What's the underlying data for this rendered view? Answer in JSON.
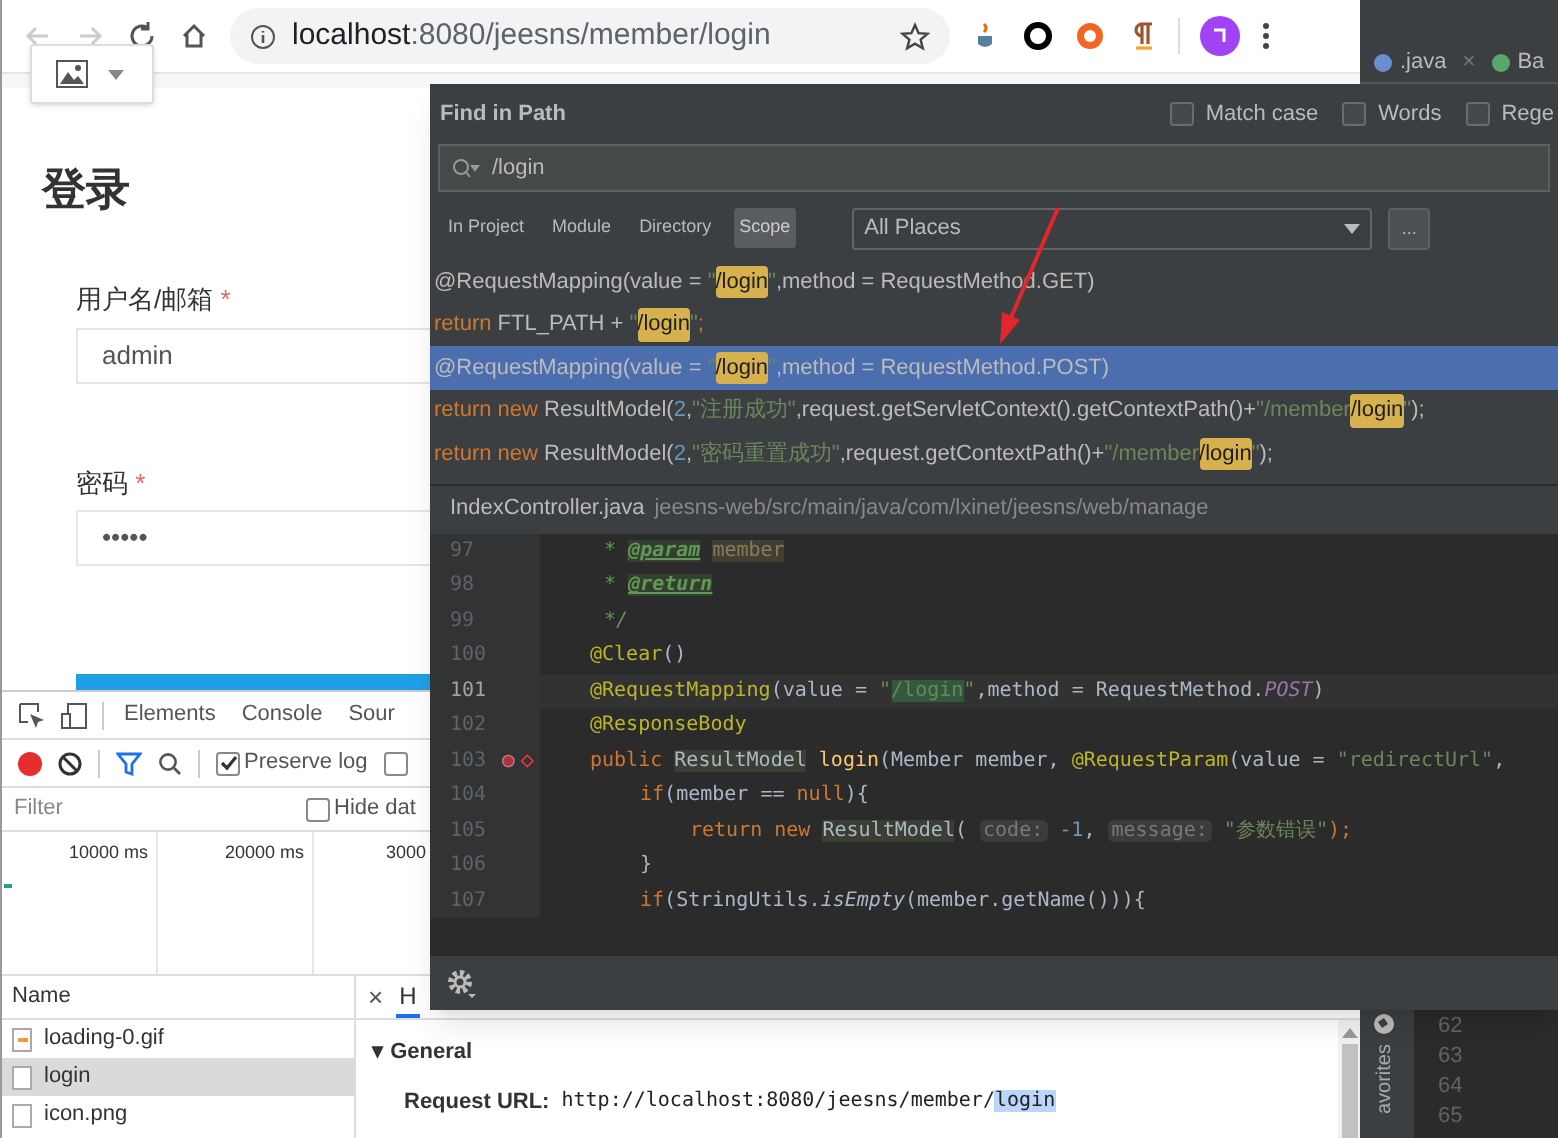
{
  "browser": {
    "address": {
      "host": "localhost",
      "rest": ":8080/jeesns/member/login"
    },
    "page": {
      "title": "登录",
      "fields": [
        {
          "label": "用户名/邮箱",
          "required_mark": "*",
          "value": "admin"
        },
        {
          "label": "密码",
          "required_mark": "*",
          "value": "•••••"
        }
      ]
    },
    "devtools": {
      "tabs": [
        {
          "label": "Elements",
          "selected": false
        },
        {
          "label": "Console",
          "selected": false
        },
        {
          "label": "Sour",
          "selected": false
        }
      ],
      "preserve_log": {
        "label": "Preserve log",
        "checked": true
      },
      "checkbox_2": {
        "checked": false
      },
      "filter": {
        "placeholder": "Filter"
      },
      "hide_data": {
        "label": "Hide dat",
        "checked": false
      },
      "timeline_ticks": [
        "10000 ms",
        "20000 ms",
        "3000"
      ],
      "name_header": "Name",
      "requests": [
        {
          "name": "loading-0.gif",
          "kind": "gif",
          "selected": false
        },
        {
          "name": "login",
          "kind": "doc",
          "selected": true
        },
        {
          "name": "icon.png",
          "kind": "doc",
          "selected": false
        }
      ],
      "close": "×",
      "detail_tab": "H",
      "section_toggle": "▾",
      "section": "General",
      "request_url": {
        "label": "Request URL:",
        "value": "http://localhost:8080/jeesns/member/",
        "match": "login"
      }
    }
  },
  "ide": {
    "tabs": [
      {
        "label": ".java",
        "close": "×"
      },
      {
        "label": "Ba"
      }
    ],
    "side_label": "avorites",
    "line_numbers": [
      "62",
      "63",
      "64",
      "65"
    ]
  },
  "find": {
    "title": "Find in Path",
    "options": [
      {
        "label": "Match case",
        "checked": false
      },
      {
        "label": "Words",
        "checked": false
      },
      {
        "label": "Rege",
        "checked": false
      }
    ],
    "query": "/login",
    "scopes": [
      {
        "label": "In Project",
        "selected": false
      },
      {
        "label": "Module",
        "selected": false
      },
      {
        "label": "Directory",
        "selected": false
      },
      {
        "label": "Scope",
        "selected": true
      }
    ],
    "scope_value": "All Places",
    "more": "...",
    "results": [
      {
        "selected": false,
        "segments": [
          {
            "t": "@RequestMapping(value = ",
            "kind": "plain"
          },
          {
            "t": "\"",
            "kind": "string"
          },
          {
            "t": "/login",
            "kind": "match"
          },
          {
            "t": "\"",
            "kind": "string"
          },
          {
            "t": ",method = RequestMethod.GET)",
            "kind": "plain"
          }
        ]
      },
      {
        "selected": false,
        "segments": [
          {
            "t": "return",
            "kind": "keyword"
          },
          {
            "t": " FTL_PATH + ",
            "kind": "plain"
          },
          {
            "t": "\"",
            "kind": "string"
          },
          {
            "t": "/login",
            "kind": "match"
          },
          {
            "t": "\"",
            "kind": "string"
          },
          {
            "t": ";",
            "kind": "keyword"
          }
        ]
      },
      {
        "selected": true,
        "segments": [
          {
            "t": "@RequestMapping(value = ",
            "kind": "plain"
          },
          {
            "t": "\"",
            "kind": "string"
          },
          {
            "t": "/login",
            "kind": "match"
          },
          {
            "t": "\"",
            "kind": "string"
          },
          {
            "t": ",method = RequestMethod.POST)",
            "kind": "plain"
          }
        ]
      },
      {
        "selected": false,
        "segments": [
          {
            "t": "return new",
            "kind": "keyword"
          },
          {
            "t": " ResultModel(",
            "kind": "plain"
          },
          {
            "t": "2",
            "kind": "number"
          },
          {
            "t": ",",
            "kind": "plain"
          },
          {
            "t": "\"注册成功\"",
            "kind": "string"
          },
          {
            "t": ",request.getServletContext().getContextPath()+",
            "kind": "plain"
          },
          {
            "t": "\"/member",
            "kind": "string"
          },
          {
            "t": "/login",
            "kind": "match"
          },
          {
            "t": "\"",
            "kind": "string"
          },
          {
            "t": ");",
            "kind": "plain"
          }
        ]
      },
      {
        "selected": false,
        "segments": [
          {
            "t": "return new",
            "kind": "keyword"
          },
          {
            "t": " ResultModel(",
            "kind": "plain"
          },
          {
            "t": "2",
            "kind": "number"
          },
          {
            "t": ",",
            "kind": "plain"
          },
          {
            "t": "\"密码重置成功\"",
            "kind": "string"
          },
          {
            "t": ",request.getContextPath()+",
            "kind": "plain"
          },
          {
            "t": "\"/member",
            "kind": "string"
          },
          {
            "t": "/login",
            "kind": "match"
          },
          {
            "t": "\"",
            "kind": "string"
          },
          {
            "t": ");",
            "kind": "plain"
          }
        ]
      }
    ],
    "file": {
      "name": "IndexController.java",
      "path": "jeesns-web/src/main/java/com/lxinet/jeesns/web/manage"
    },
    "code": [
      {
        "number": "97",
        "kind": "doc",
        "current": false,
        "breakpoint": false,
        "segments": [
          {
            "t": "* ",
            "kind": "comment"
          },
          {
            "t": "@param",
            "kind": "doc_tag"
          },
          {
            "t": "member",
            "kind": "doc_ref"
          }
        ]
      },
      {
        "number": "98",
        "kind": "doc",
        "current": false,
        "breakpoint": false,
        "segments": [
          {
            "t": "* ",
            "kind": "comment"
          },
          {
            "t": "@return",
            "kind": "doc_tag"
          }
        ]
      },
      {
        "number": "99",
        "kind": "doc",
        "current": false,
        "breakpoint": false,
        "segments": [
          {
            "t": "*/",
            "kind": "comment"
          }
        ]
      },
      {
        "number": "100",
        "kind": "member",
        "current": false,
        "breakpoint": false,
        "segments": [
          {
            "t": "@Clear",
            "kind": "annotation"
          },
          {
            "t": "()",
            "kind": "plain"
          }
        ]
      },
      {
        "number": "101",
        "kind": "member",
        "current": true,
        "breakpoint": false,
        "segments": [
          {
            "t": "@RequestMapping",
            "kind": "annotation"
          },
          {
            "t": "(value = ",
            "kind": "plain"
          },
          {
            "t": "\"",
            "kind": "string"
          },
          {
            "t": "/login",
            "kind": "match"
          },
          {
            "t": "\"",
            "kind": "string"
          },
          {
            "t": ",method = RequestMethod.",
            "kind": "plain"
          },
          {
            "t": "POST",
            "kind": "constant"
          },
          {
            "t": ")",
            "kind": "plain"
          }
        ]
      },
      {
        "number": "102",
        "kind": "member",
        "current": false,
        "breakpoint": false,
        "segments": [
          {
            "t": "@ResponseBody",
            "kind": "annotation"
          }
        ]
      },
      {
        "number": "103",
        "kind": "member",
        "current": false,
        "breakpoint": true,
        "segments": [
          {
            "t": "public ",
            "kind": "keyword"
          },
          {
            "t": "ResultModel",
            "kind": "type_hl"
          },
          {
            "t": " login",
            "kind": "method"
          },
          {
            "t": "(Member member, ",
            "kind": "plain"
          },
          {
            "t": "@RequestParam",
            "kind": "annotation"
          },
          {
            "t": "(value = ",
            "kind": "plain"
          },
          {
            "t": "\"redirectUrl\"",
            "kind": "string"
          },
          {
            "t": ",",
            "kind": "plain"
          }
        ]
      },
      {
        "number": "104",
        "kind": "body",
        "current": false,
        "breakpoint": false,
        "segments": [
          {
            "t": "if",
            "kind": "keyword"
          },
          {
            "t": "(member == ",
            "kind": "plain"
          },
          {
            "t": "null",
            "kind": "keyword"
          },
          {
            "t": "){",
            "kind": "plain"
          }
        ]
      },
      {
        "number": "105",
        "kind": "inner",
        "current": false,
        "breakpoint": false,
        "segments": [
          {
            "t": "return new ",
            "kind": "keyword"
          },
          {
            "t": "ResultModel",
            "kind": "type_hl"
          },
          {
            "t": "( ",
            "kind": "plain"
          },
          {
            "t": "code:",
            "kind": "hint"
          },
          {
            "t": " -1",
            "kind": "number"
          },
          {
            "t": ", ",
            "kind": "plain"
          },
          {
            "t": "message:",
            "kind": "hint"
          },
          {
            "t": " \"参数错误\"",
            "kind": "string"
          },
          {
            "t": ");",
            "kind": "keyword"
          }
        ]
      },
      {
        "number": "106",
        "kind": "body",
        "current": false,
        "breakpoint": false,
        "segments": [
          {
            "t": "}",
            "kind": "plain"
          }
        ]
      },
      {
        "number": "107",
        "kind": "body",
        "current": false,
        "breakpoint": false,
        "segments": [
          {
            "t": "if",
            "kind": "keyword"
          },
          {
            "t": "(StringUtils.",
            "kind": "plain"
          },
          {
            "t": "isEmpty",
            "kind": "static"
          },
          {
            "t": "(member.getName())){",
            "kind": "plain"
          }
        ]
      }
    ]
  }
}
